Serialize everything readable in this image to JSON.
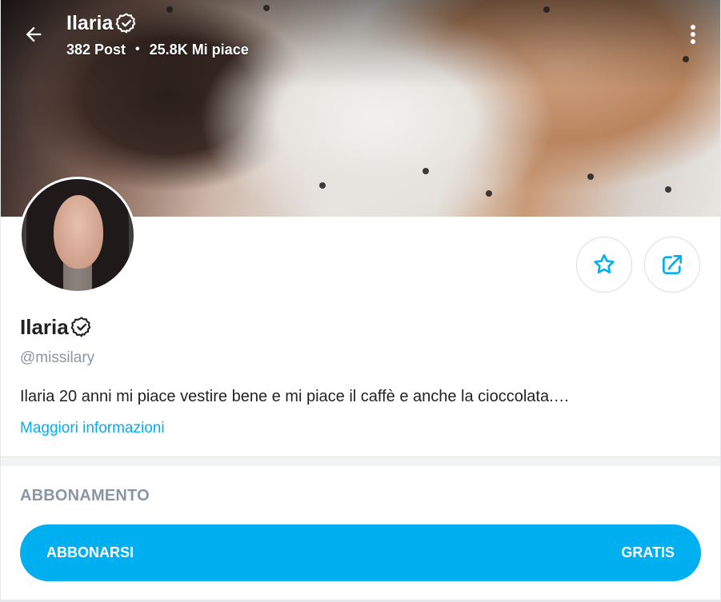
{
  "header": {
    "name": "Ilaria",
    "posts": "382 Post",
    "separator": "•",
    "likes": "25.8K Mi piace",
    "back_icon": "arrow-left-icon",
    "more_icon": "more-vertical-icon"
  },
  "profile": {
    "name": "Ilaria",
    "username": "@missilary",
    "bio": "Ilaria 20 anni mi piace vestire bene e mi piace il caffè e anche la cioccolata.…",
    "more_info": "Maggiori informazioni",
    "verified_icon": "verified-badge-icon"
  },
  "actions": {
    "favorite_icon": "star-icon",
    "share_icon": "share-icon"
  },
  "subscription": {
    "section_title": "ABBONAMENTO",
    "button_label": "ABBONARSI",
    "price_label": "GRATIS"
  },
  "colors": {
    "accent": "#00aff0",
    "muted_text": "#8a96a3",
    "text": "#222222",
    "border": "#d9dde2"
  }
}
